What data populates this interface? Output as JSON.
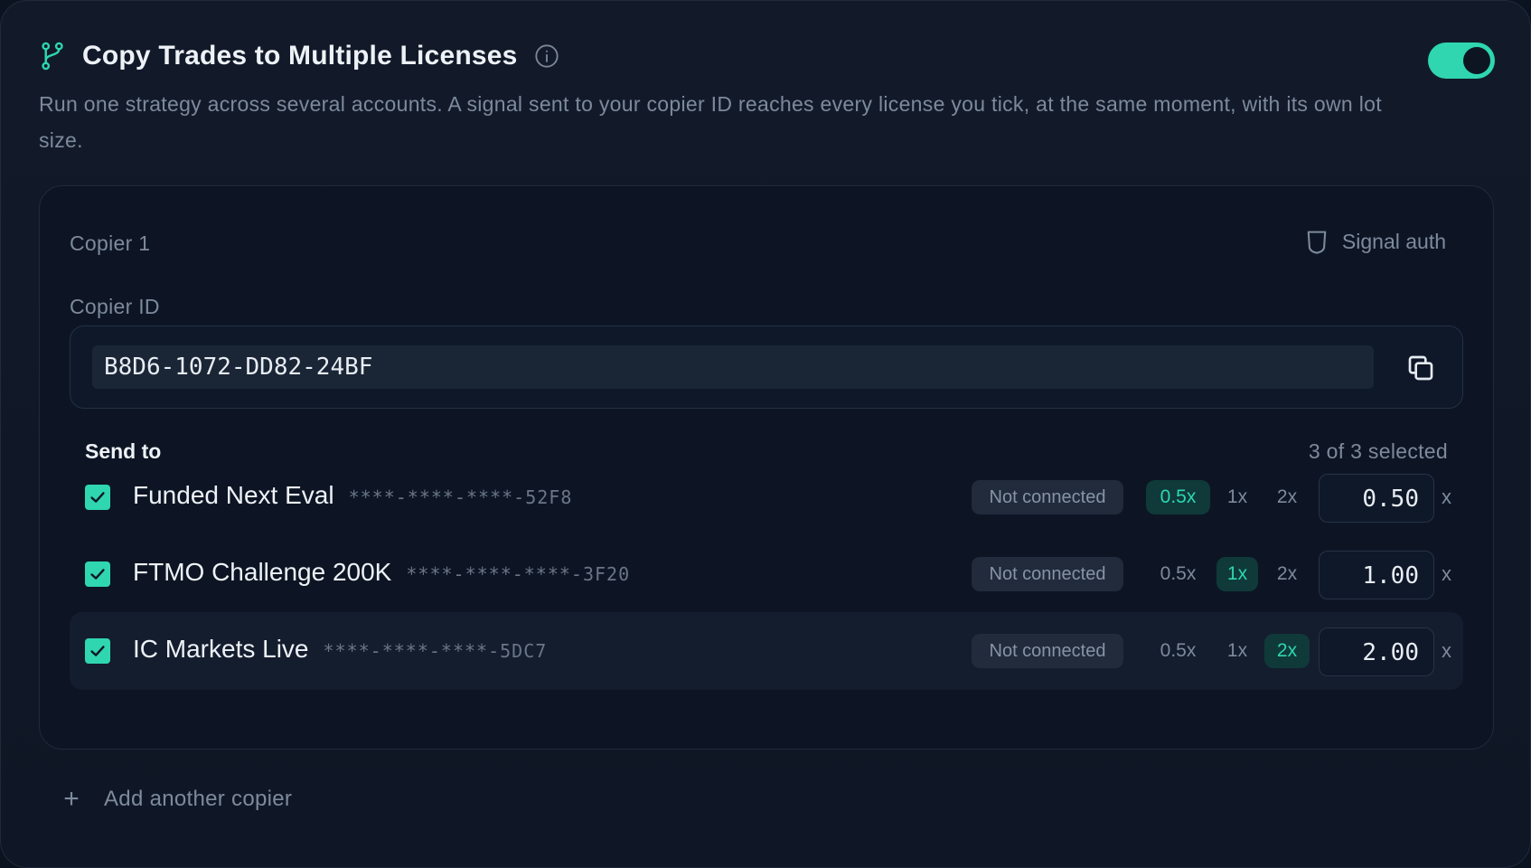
{
  "header": {
    "title": "Copy Trades to Multiple Licenses",
    "description": "Run one strategy across several accounts. A signal sent to your copier ID reaches every license you tick, at the same moment, with its own lot size.",
    "toggle_on": true,
    "icons": {
      "title": "branch-icon",
      "info": "info-icon"
    }
  },
  "copier": {
    "name": "Copier 1",
    "signal_auth_label": "Signal auth",
    "copier_id_label": "Copier ID",
    "copier_id_value": "B8D6-1072-DD82-24BF",
    "send_to_label": "Send to",
    "selected_count": "3 of 3 selected",
    "multiplier_options": [
      "0.5x",
      "1x",
      "2x"
    ],
    "lot_suffix": "x",
    "accounts": [
      {
        "name": "Funded Next Eval",
        "key": "****-****-****-52F8",
        "status": "Not connected",
        "active_multiplier": "0.5x",
        "lot": "0.50",
        "checked": true
      },
      {
        "name": "FTMO Challenge 200K",
        "key": "****-****-****-3F20",
        "status": "Not connected",
        "active_multiplier": "1x",
        "lot": "1.00",
        "checked": true
      },
      {
        "name": "IC Markets Live",
        "key": "****-****-****-5DC7",
        "status": "Not connected",
        "active_multiplier": "2x",
        "lot": "2.00",
        "checked": true
      }
    ]
  },
  "footer": {
    "add_copier_label": "Add another copier",
    "add_icon": "+"
  },
  "colors": {
    "accent": "#2fd6b0",
    "background": "#0f1726",
    "card": "#0d1524",
    "muted_text": "#7d8a9c"
  }
}
